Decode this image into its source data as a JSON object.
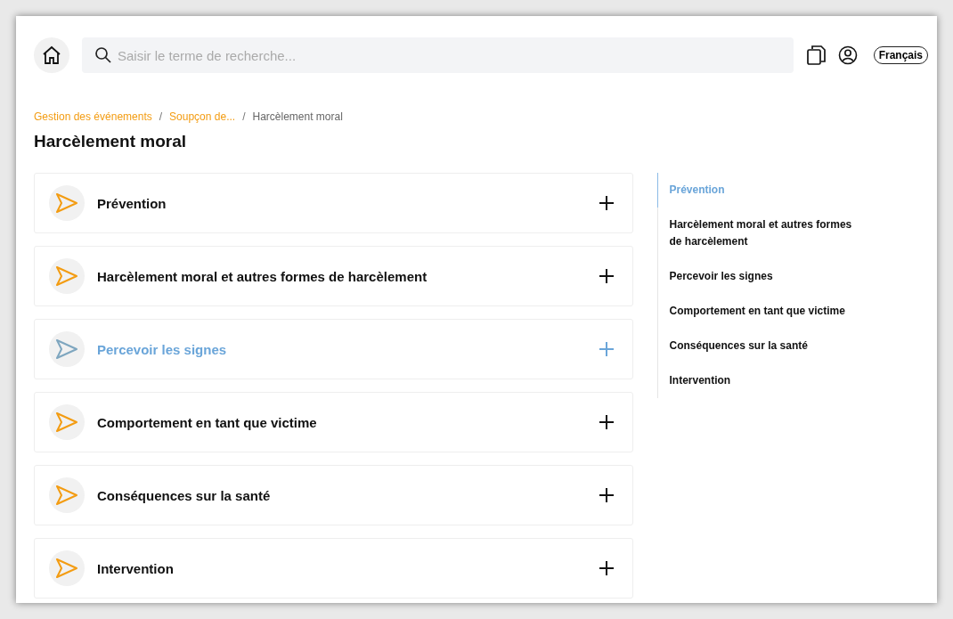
{
  "search": {
    "placeholder": "Saisir le terme de recherche..."
  },
  "language": "Français",
  "breadcrumb": [
    {
      "label": "Gestion des événements",
      "kind": "link"
    },
    {
      "label": "/",
      "kind": "separator"
    },
    {
      "label": "Soupçon de...",
      "kind": "link"
    },
    {
      "label": "/",
      "kind": "separator"
    },
    {
      "label": "Harcèlement moral",
      "kind": "current"
    }
  ],
  "title": "Harcèlement moral",
  "sections": [
    {
      "label": "Prévention",
      "highlighted": false
    },
    {
      "label": "Harcèlement moral et autres formes de harcèlement",
      "highlighted": false
    },
    {
      "label": "Percevoir les signes",
      "highlighted": true
    },
    {
      "label": "Comportement en tant que victime",
      "highlighted": false
    },
    {
      "label": "Conséquences sur la santé",
      "highlighted": false
    },
    {
      "label": "Intervention",
      "highlighted": false
    }
  ],
  "toc": [
    {
      "label": "Prévention",
      "selected": true
    },
    {
      "label": "Harcèlement moral et autres formes de harcèlement",
      "selected": false
    },
    {
      "label": "Percevoir les signes",
      "selected": false
    },
    {
      "label": "Comportement en tant que victime",
      "selected": false
    },
    {
      "label": "Conséquences sur la santé",
      "selected": false
    },
    {
      "label": "Intervention",
      "selected": false
    }
  ]
}
